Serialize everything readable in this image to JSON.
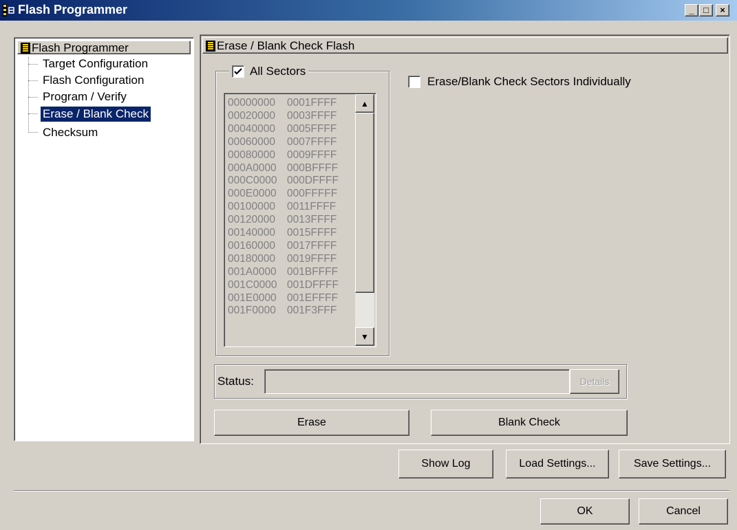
{
  "window": {
    "title": "Flash Programmer"
  },
  "tree": {
    "root": "Flash Programmer",
    "items": [
      {
        "label": "Target Configuration",
        "selected": false
      },
      {
        "label": "Flash Configuration",
        "selected": false
      },
      {
        "label": "Program / Verify",
        "selected": false
      },
      {
        "label": "Erase / Blank Check",
        "selected": true
      },
      {
        "label": "Checksum",
        "selected": false
      }
    ]
  },
  "panel": {
    "title": "Erase / Blank Check Flash",
    "all_sectors_label": "All Sectors",
    "all_sectors_checked": true,
    "individual_label": "Erase/Blank Check Sectors Individually",
    "individual_checked": false,
    "sectors": [
      [
        "00000000",
        "0001FFFF"
      ],
      [
        "00020000",
        "0003FFFF"
      ],
      [
        "00040000",
        "0005FFFF"
      ],
      [
        "00060000",
        "0007FFFF"
      ],
      [
        "00080000",
        "0009FFFF"
      ],
      [
        "000A0000",
        "000BFFFF"
      ],
      [
        "000C0000",
        "000DFFFF"
      ],
      [
        "000E0000",
        "000FFFFF"
      ],
      [
        "00100000",
        "0011FFFF"
      ],
      [
        "00120000",
        "0013FFFF"
      ],
      [
        "00140000",
        "0015FFFF"
      ],
      [
        "00160000",
        "0017FFFF"
      ],
      [
        "00180000",
        "0019FFFF"
      ],
      [
        "001A0000",
        "001BFFFF"
      ],
      [
        "001C0000",
        "001DFFFF"
      ],
      [
        "001E0000",
        "001EFFFF"
      ],
      [
        "001F0000",
        "001F3FFF"
      ]
    ],
    "status_label": "Status:",
    "status_value": "",
    "details_label": "Details",
    "erase_label": "Erase",
    "blank_check_label": "Blank Check"
  },
  "buttons": {
    "show_log": "Show Log",
    "load_settings": "Load Settings...",
    "save_settings": "Save Settings...",
    "ok": "OK",
    "cancel": "Cancel"
  },
  "caption_buttons": {
    "minimize": "_",
    "maximize": "□",
    "close": "×"
  }
}
